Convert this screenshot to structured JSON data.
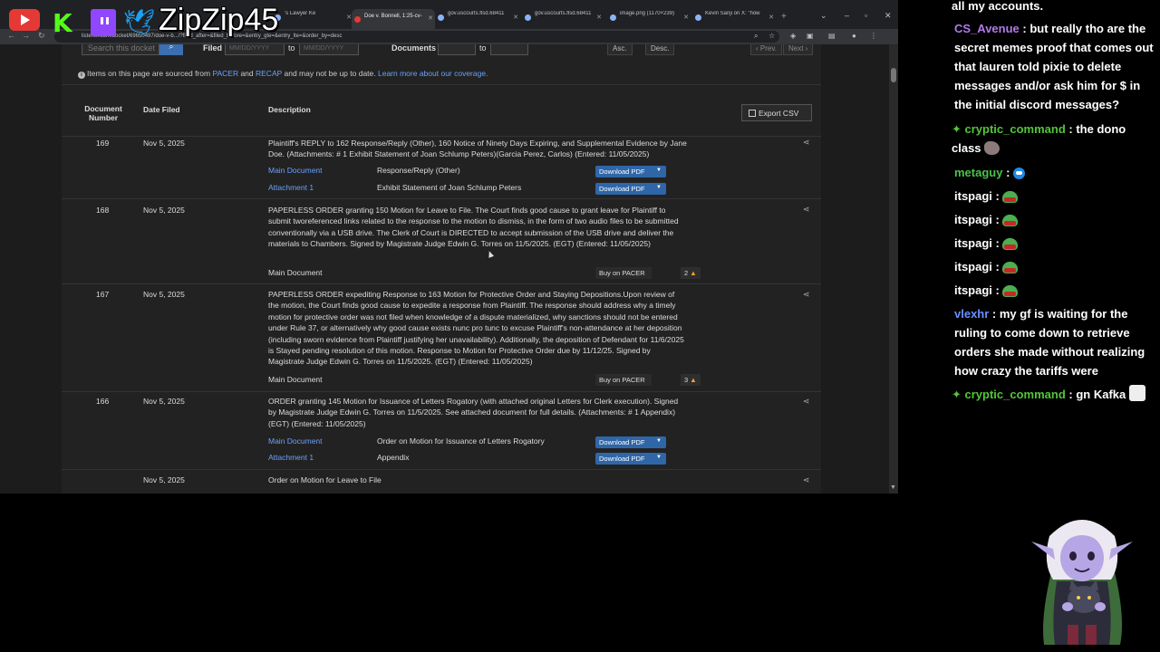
{
  "overlay": {
    "handle": "ZipZip45",
    "icons": [
      "youtube-icon",
      "kick-icon",
      "twitch-icon",
      "twitter-icon"
    ]
  },
  "browser": {
    "tabs": [
      {
        "label": "'s Lawyer Ke",
        "active": false
      },
      {
        "label": "Doe v. Bonnell, 1:25-cv-",
        "active": true
      },
      {
        "label": "gov.uscourts.flsd.68411",
        "active": false
      },
      {
        "label": "gov.uscourts.flsd.68411",
        "active": false
      },
      {
        "label": "image.png (1170×239)",
        "active": false
      },
      {
        "label": "Kevin Sanji on X: \"how",
        "active": false
      }
    ],
    "url": "listener.com/docket/69650497/doe-v-b.../?filed_after=&filed_before=&entry_gte=&entry_lte=&order_by=desc"
  },
  "docket": {
    "search_placeholder": "Search this docket",
    "filed_label": "Filed",
    "date_placeholder": "MM/DD/YYYY",
    "to_label": "to",
    "documents_label": "Documents",
    "asc_label": "Asc.",
    "desc_label": "Desc.",
    "prev_label": "‹ Prev.",
    "next_label": "Next ›",
    "info": {
      "prefix": "Items on this page are sourced from ",
      "pacer": "PACER",
      "and": " and ",
      "recap": "RECAP",
      "suffix": " and may not be up to date. ",
      "learn_more": "Learn more about our coverage."
    },
    "headers": {
      "doc_number_line1": "Document",
      "doc_number_line2": "Number",
      "date_filed": "Date Filed",
      "description": "Description"
    },
    "export_label": "Export CSV",
    "entries": [
      {
        "number": "169",
        "date": "Nov 5, 2025",
        "description": "Plaintiff's REPLY to 162 Response/Reply (Other), 160 Notice of Ninety Days Expiring, and Supplemental Evidence by Jane Doe. (Attachments: # 1 Exhibit Statement of Joan Schlump Peters)(Garcia Perez, Carlos) (Entered: 11/05/2025)",
        "subs": [
          {
            "name": "Main Document",
            "desc": "Response/Reply (Other)",
            "action": "Download PDF"
          },
          {
            "name": "Attachment 1",
            "desc": "Exhibit Statement of Joan Schlump Peters",
            "action": "Download PDF"
          }
        ]
      },
      {
        "number": "168",
        "date": "Nov 5, 2025",
        "description": "PAPERLESS ORDER granting 150 Motion for Leave to File. The Court finds good cause to grant leave for Plaintiff to submit tworeferenced links related to the response to the motion to dismiss, in the form of two audio files to be submitted conventionally via a USB drive. The Clerk of Court is DIRECTED to accept submission of the USB drive and deliver the materials to Chambers. Signed by Magistrate Judge Edwin G. Torres on 11/5/2025. (EGT) (Entered: 11/05/2025)",
        "subs": [
          {
            "name": "Main Document",
            "desc": "",
            "action": "Buy on PACER",
            "badge": "2"
          }
        ]
      },
      {
        "number": "167",
        "date": "Nov 5, 2025",
        "description": "PAPERLESS ORDER expediting Response to 163 Motion for Protective Order and Staying Depositions.Upon review of the motion, the Court finds good cause to expedite a response from Plaintiff. The response should address why a timely motion for protective order was not filed when knowledge of a dispute materialized, why sanctions should not be entered under Rule 37, or alternatively why good cause exists nunc pro tunc to excuse Plaintiff's non-attendance at her deposition (including sworn evidence from Plaintiff justifying her unavailability). Additionally, the deposition of Defendant for 11/6/2025 is Stayed pending resolution of this motion. Response to Motion for Protective Order due by 11/12/25. Signed by Magistrate Judge Edwin G. Torres on 11/5/2025. (EGT) (Entered: 11/05/2025)",
        "subs": [
          {
            "name": "Main Document",
            "desc": "",
            "action": "Buy on PACER",
            "badge": "3"
          }
        ]
      },
      {
        "number": "166",
        "date": "Nov 5, 2025",
        "description": "ORDER granting 145 Motion for Issuance of Letters Rogatory (with attached original Letters for Clerk execution). Signed by Magistrate Judge Edwin G. Torres on 11/5/2025. See attached document for full details. (Attachments: # 1 Appendix) (EGT) (Entered: 11/05/2025)",
        "subs": [
          {
            "name": "Main Document",
            "desc": "Order on Motion for Issuance of Letters Rogatory",
            "action": "Download PDF"
          },
          {
            "name": "Attachment 1",
            "desc": "Appendix",
            "action": "Download PDF"
          }
        ]
      },
      {
        "number": "",
        "date": "Nov 5, 2025",
        "description": "Order on Motion for Leave to File",
        "subs": []
      }
    ]
  },
  "chat": {
    "messages": [
      {
        "user": "",
        "text": "all my accounts.",
        "user_color": "#ffffff",
        "badge": false,
        "emote": ""
      },
      {
        "user": "CS_Avenue",
        "text": "but really tho are the secret memes proof that comes out that lauren told pixie to delete messages and/or ask him for $ in the initial discord messages?",
        "user_color": "#b07be8",
        "badge": false,
        "emote": ""
      },
      {
        "user": "cryptic_command",
        "text": "the dono class",
        "user_color": "#53c43a",
        "badge": true,
        "emote": "gray"
      },
      {
        "user": "metaguy",
        "text": "",
        "user_color": "#4ac24a",
        "badge": false,
        "emote": "blob"
      },
      {
        "user": "itspagi",
        "text": "",
        "user_color": "#ffffff",
        "badge": false,
        "emote": "frog"
      },
      {
        "user": "itspagi",
        "text": "",
        "user_color": "#ffffff",
        "badge": false,
        "emote": "frog"
      },
      {
        "user": "itspagi",
        "text": "",
        "user_color": "#ffffff",
        "badge": false,
        "emote": "frog"
      },
      {
        "user": "itspagi",
        "text": "",
        "user_color": "#ffffff",
        "badge": false,
        "emote": "frog"
      },
      {
        "user": "itspagi",
        "text": "",
        "user_color": "#ffffff",
        "badge": false,
        "emote": "frog"
      },
      {
        "user": "vlexhr",
        "text": "my gf is waiting for the ruling to come down to retrieve orders she made without realizing how crazy the tariffs were",
        "user_color": "#6a8fff",
        "badge": false,
        "emote": ""
      },
      {
        "user": "cryptic_command",
        "text": "gn Kafka",
        "user_color": "#53c43a",
        "badge": true,
        "emote": "ghost"
      }
    ]
  },
  "colors": {
    "link": "#6aa0ff",
    "download_button": "#2f66a8",
    "youtube": "#e53935",
    "twitch": "#9146ff",
    "kick": "#53fc18",
    "twitter": "#1da1f2"
  }
}
